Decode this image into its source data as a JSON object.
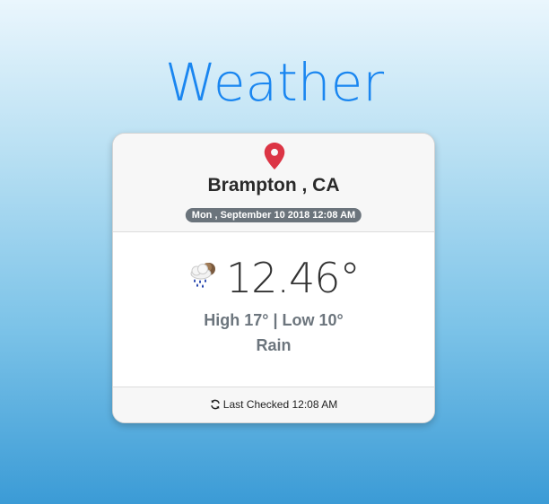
{
  "app": {
    "title": "Weather"
  },
  "card": {
    "location_icon": "map-marker-icon",
    "location": "Brampton , CA",
    "date": "Mon , September 10 2018 12:08 AM",
    "weather_icon": "rain-cloud-icon",
    "temperature": "12.46°",
    "high_low": "High 17° | Low 10°",
    "condition": "Rain",
    "footer_icon": "refresh-icon",
    "last_checked": "Last Checked 12:08 AM"
  },
  "colors": {
    "accent": "#1a86f0",
    "pin": "#dc3545",
    "badge": "#6b747c",
    "muted_text": "#6c757d"
  }
}
